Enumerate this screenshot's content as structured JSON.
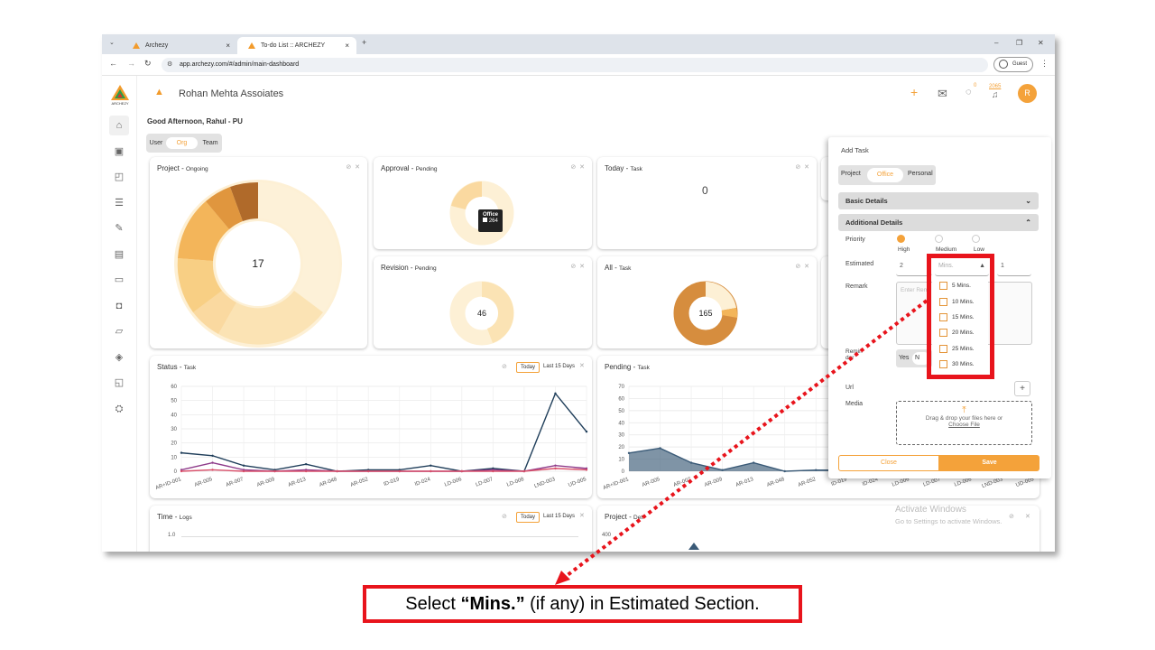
{
  "browser": {
    "tabs": [
      {
        "label": "Archezy",
        "close": "×"
      },
      {
        "label": "To-do List :: ARCHEZY",
        "close": "×"
      }
    ],
    "new_tab": "+",
    "window_controls": [
      "–",
      "❐",
      "✕"
    ],
    "url": "app.archezy.com/#/admin/main-dashboard",
    "profile": "Guest"
  },
  "app": {
    "logo_text": "ARCHEZY",
    "org_name": "Rohan Mehta Assoiates",
    "greeting": "Good Afternoon, Rahul - PU",
    "scope_tabs": [
      "User",
      "Org",
      "Team"
    ],
    "active_scope": "Org",
    "header_badges": {
      "messages": "0",
      "notifications": "2065"
    },
    "avatar": "R",
    "sidebar_icons": [
      "home-icon",
      "id-card-icon",
      "clipboard-icon",
      "list-icon",
      "edit-icon",
      "contacts-icon",
      "book-icon",
      "briefcase-icon",
      "folder-icon",
      "shield-icon",
      "reports-icon",
      "network-icon"
    ]
  },
  "cards": {
    "project": {
      "title": "Project",
      "sub": "Ongoing",
      "center": "17"
    },
    "approval": {
      "title": "Approval",
      "sub": "Pending",
      "tooltip_label": "Office",
      "tooltip_value": "264"
    },
    "today": {
      "title": "Today",
      "sub": "Task",
      "value": "0"
    },
    "revision": {
      "title": "Revision",
      "sub": "Pending",
      "center": "46"
    },
    "all": {
      "title": "All",
      "sub": "Task",
      "center": "165"
    },
    "status": {
      "title": "Status",
      "sub": "Task",
      "btn_today": "Today",
      "btn_15": "Last 15 Days"
    },
    "pending": {
      "title": "Pending",
      "sub": "Task"
    },
    "time": {
      "title": "Time",
      "sub": "Logs",
      "btn_today": "Today",
      "btn_15": "Last 15 Days",
      "y_top": "1.0"
    },
    "project2": {
      "title": "Project",
      "sub": "Det",
      "y_top": "400"
    }
  },
  "chart_data": [
    {
      "type": "line",
      "title": "Status - Task",
      "categories": [
        "AR+ID-001",
        "AR-005",
        "AR-007",
        "AR-009",
        "AR-013",
        "AR-048",
        "AR-052",
        "ID-019",
        "ID-024",
        "LD-006",
        "LD-007",
        "LD-008",
        "LND-003",
        "UD-005"
      ],
      "ylim": [
        0,
        60
      ],
      "yticks": [
        0,
        10,
        20,
        30,
        40,
        50,
        60
      ],
      "series": [
        {
          "color": "#1f3e5a",
          "values": [
            13,
            11,
            4,
            1,
            5,
            0,
            1,
            1,
            4,
            0,
            2,
            0,
            55,
            28
          ]
        },
        {
          "color": "#8e3b8a",
          "values": [
            1,
            6,
            1,
            0,
            1,
            0,
            0,
            0,
            0,
            0,
            1,
            0,
            4,
            2
          ]
        },
        {
          "color": "#d94f6a",
          "values": [
            0,
            1,
            0,
            0,
            0,
            0,
            0,
            0,
            0,
            0,
            0,
            0,
            2,
            1
          ]
        }
      ]
    },
    {
      "type": "area",
      "title": "Pending - Task",
      "categories": [
        "AR+ID-001",
        "AR-005",
        "AR-007",
        "AR-009",
        "AR-013",
        "AR-048",
        "AR-052",
        "ID-019",
        "ID-024",
        "LD-006",
        "LD-007",
        "LD-008",
        "LND-003",
        "UD-005"
      ],
      "ylim": [
        0,
        70
      ],
      "yticks": [
        0,
        10,
        20,
        30,
        40,
        50,
        60,
        70
      ],
      "series": [
        {
          "color": "#3a5a77",
          "values": [
            15,
            19,
            7,
            1,
            7,
            0,
            1,
            1,
            1,
            0,
            0,
            0,
            0,
            0
          ]
        }
      ]
    }
  ],
  "panel": {
    "title": "Add Task",
    "type_tabs": [
      "Project",
      "Office",
      "Personal"
    ],
    "active_type": "Office",
    "sections": {
      "basic": "Basic Details",
      "additional": "Additional Details"
    },
    "priority_label": "Priority",
    "priorities": [
      "High",
      "Medium",
      "Low"
    ],
    "selected_priority": "High",
    "estimated_label": "Estimated",
    "estimated_hours": "2",
    "estimated_mins_placeholder": "Mins.",
    "estimated_extra": "1",
    "remark_label": "Remark",
    "remark_placeholder": "Enter Rem",
    "reminder_label": "Remin\nder",
    "reminder_yes": "Yes",
    "reminder_no": "N",
    "url_label": "Url",
    "media_label": "Media",
    "dropzone_text": "Drag & drop your files here or",
    "dropzone_link": "Choose File",
    "close_btn": "Close",
    "save_btn": "Save",
    "mins_options": [
      "5 Mins.",
      "10 Mins.",
      "15 Mins.",
      "20 Mins.",
      "25 Mins.",
      "30 Mins."
    ]
  },
  "watermark": {
    "line1": "Activate Windows",
    "line2": "Go to Settings to activate Windows."
  },
  "caption": {
    "pre": "Select ",
    "bold": "“Mins.”",
    "post": " (if any) in Estimated Section."
  },
  "colors": {
    "accent": "#f4a23a",
    "annotation_red": "#e8141c"
  }
}
